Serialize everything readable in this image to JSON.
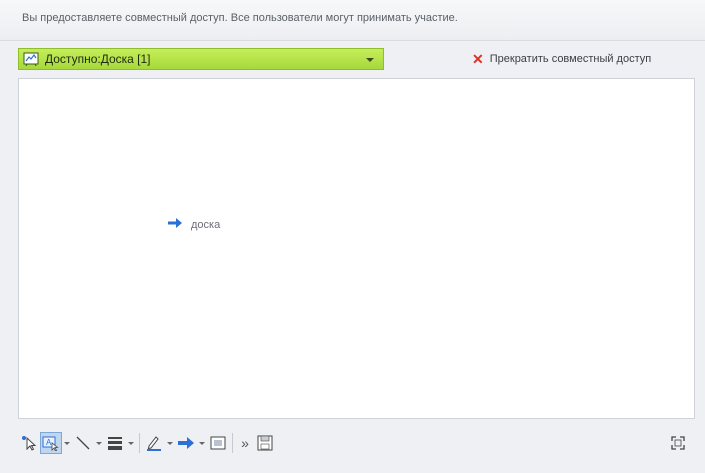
{
  "info": {
    "text": "Вы предоставляете совместный доступ. Все пользователи могут принимать участие."
  },
  "share": {
    "label": "Доступно:Доска [1]",
    "stop_label": "Прекратить совместный доступ"
  },
  "board": {
    "item_label": "доска"
  },
  "colors": {
    "accent_green": "#b3e24a",
    "stop_red": "#e0302a",
    "arrow_blue": "#2c6fd6"
  },
  "toolbar": {
    "more_label": "»"
  }
}
